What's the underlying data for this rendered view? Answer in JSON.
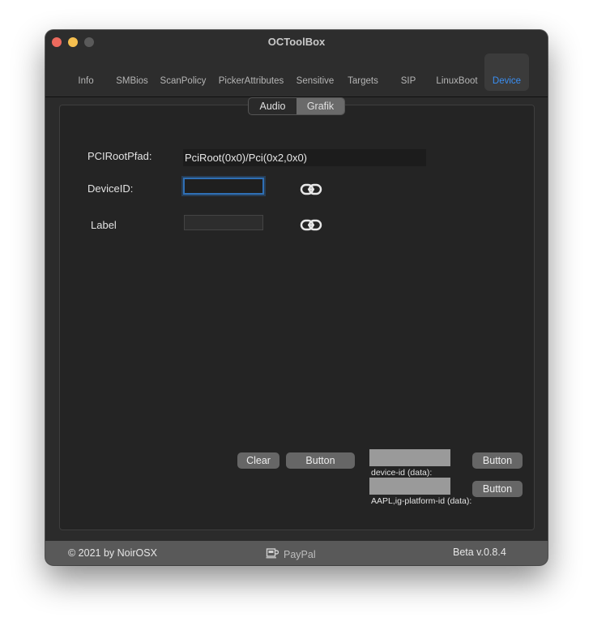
{
  "window": {
    "title": "OCToolBox"
  },
  "tabs": [
    {
      "label": "Info"
    },
    {
      "label": "SMBios"
    },
    {
      "label": "ScanPolicy"
    },
    {
      "label": "PickerAttributes"
    },
    {
      "label": "Sensitive"
    },
    {
      "label": "Targets"
    },
    {
      "label": "SIP"
    },
    {
      "label": "LinuxBoot"
    },
    {
      "label": "Device"
    }
  ],
  "active_tab": "Device",
  "segments": [
    {
      "label": "Audio"
    },
    {
      "label": "Grafik"
    }
  ],
  "active_segment": "Grafik",
  "form": {
    "pciroot_label": "PCIRootPfad:",
    "pciroot_value": "PciRoot(0x0)/Pci(0x2,0x0)",
    "deviceid_label": "DeviceID:",
    "deviceid_value": "",
    "label_label": "Label",
    "label_value": ""
  },
  "actions": {
    "clear_label": "Clear",
    "button1_label": "Button",
    "button2_label": "Button",
    "button3_label": "Button",
    "device_id_caption": "device-id (data):",
    "platform_id_caption": "AAPL,ig-platform-id (data):"
  },
  "footer": {
    "copyright": "©  2021 by NoirOSX",
    "paypal": "PayPal",
    "version": "Beta v.0.8.4"
  },
  "colors": {
    "accent": "#3b8ff3",
    "close": "#ed6a5e",
    "minimize": "#f5bf4f",
    "maximize_disabled": "#5a5a5a"
  }
}
